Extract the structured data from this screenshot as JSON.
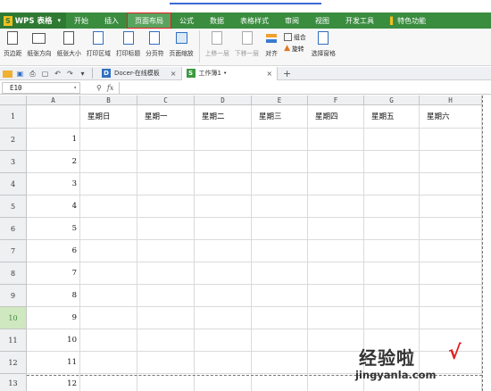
{
  "app": {
    "logo_letter": "S",
    "name": "WPS 表格",
    "accent": "#3a8c3f",
    "highlight": "#e02020"
  },
  "menu_tabs": [
    {
      "label": "开始",
      "active": false
    },
    {
      "label": "插入",
      "active": false
    },
    {
      "label": "页面布局",
      "active": true
    },
    {
      "label": "公式",
      "active": false
    },
    {
      "label": "数据",
      "active": false
    },
    {
      "label": "表格样式",
      "active": false
    },
    {
      "label": "审阅",
      "active": false
    },
    {
      "label": "视图",
      "active": false
    },
    {
      "label": "开发工具",
      "active": false
    },
    {
      "label": "特色功能",
      "active": false
    }
  ],
  "ribbon": {
    "margins": "页边距",
    "orientation": "纸张方向",
    "size": "纸张大小",
    "print_area": "打印区域",
    "print_titles": "打印标题",
    "page_break": "分页符",
    "zoom": "页面缩放",
    "bring_forward": "上移一层",
    "send_backward": "下移一层",
    "align": "对齐",
    "group": "组合",
    "rotate": "旋转",
    "selection_pane": "选择窗格"
  },
  "doc_tabs": [
    {
      "icon": "D",
      "label": "Docer-在线模板",
      "active": false
    },
    {
      "icon": "S",
      "label": "工作簿1 •",
      "active": true
    }
  ],
  "formula_bar": {
    "cell_ref": "E10",
    "fx_label": "fx",
    "zoom_icon": "magnifier-icon"
  },
  "sheet": {
    "columns": [
      "A",
      "B",
      "C",
      "D",
      "E",
      "F",
      "G",
      "H"
    ],
    "header_row": [
      "",
      "星期日",
      "星期一",
      "星期二",
      "星期三",
      "星期四",
      "星期五",
      "星期六"
    ],
    "rows": [
      {
        "num": "1",
        "a": ""
      },
      {
        "num": "2",
        "a": "1"
      },
      {
        "num": "3",
        "a": "2"
      },
      {
        "num": "4",
        "a": "3"
      },
      {
        "num": "5",
        "a": "4"
      },
      {
        "num": "6",
        "a": "5"
      },
      {
        "num": "7",
        "a": "6"
      },
      {
        "num": "8",
        "a": "7"
      },
      {
        "num": "9",
        "a": "8"
      },
      {
        "num": "10",
        "a": "9"
      },
      {
        "num": "11",
        "a": "10"
      },
      {
        "num": "12",
        "a": "11"
      },
      {
        "num": "13",
        "a": "12"
      }
    ],
    "selected_row": "10"
  },
  "watermark": {
    "title": "经验啦",
    "check": "√",
    "url": "jingyanla.com"
  }
}
